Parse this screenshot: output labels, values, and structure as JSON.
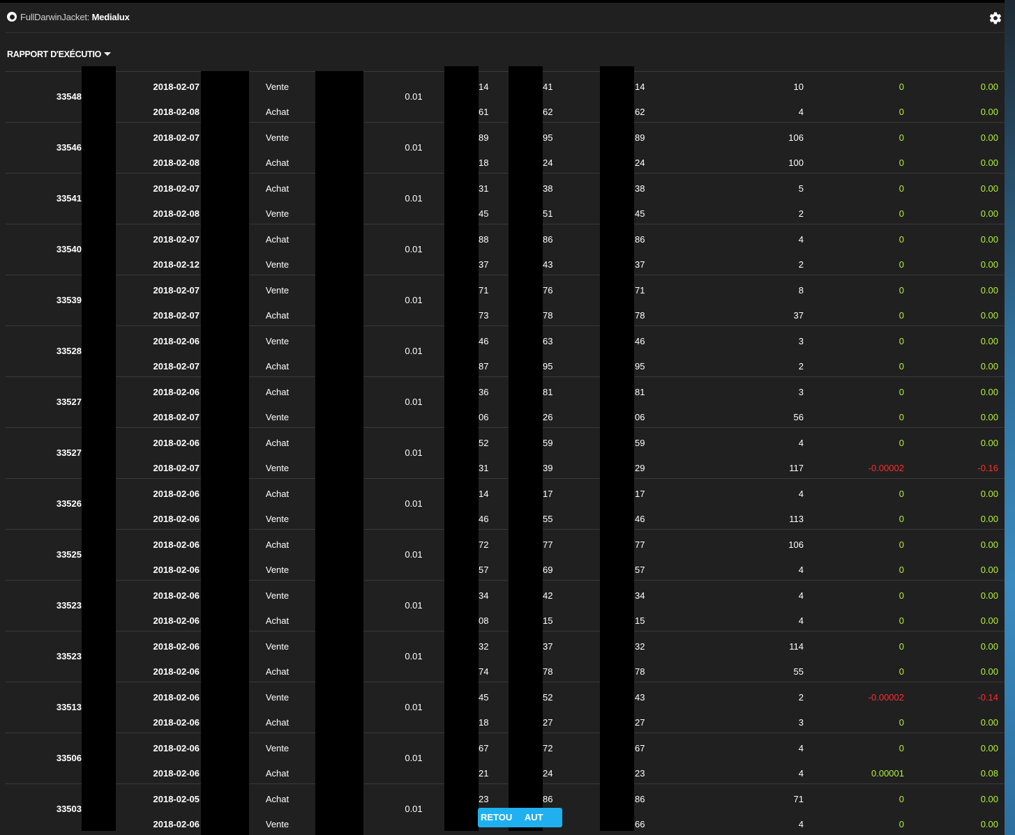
{
  "header": {
    "app_name": "FullDarwinJacket:",
    "app_bold": "Medialux"
  },
  "report_menu": {
    "label": "RAPPORT D'EXÉCUTIO"
  },
  "back_button": {
    "label": "RETOUR EN HAUT",
    "visible_text": "RETOU     AUT"
  },
  "colors": {
    "background": "#202020",
    "positive": "#b4f23a",
    "negative": "#ff2d2d",
    "accent": "#20b0f0"
  },
  "table": {
    "rows": [
      {
        "id": "33548",
        "lot": "0.01",
        "legs": [
          {
            "date": "2018-02-07",
            "type": "Vente",
            "p1": "14",
            "p2": "41",
            "p3": "14",
            "qty": "10",
            "pts": "0",
            "pl": "0.00"
          },
          {
            "date": "2018-02-08",
            "type": "Achat",
            "p1": "61",
            "p2": "62",
            "p3": "62",
            "qty": "4",
            "pts": "0",
            "pl": "0.00"
          }
        ]
      },
      {
        "id": "33546",
        "lot": "0.01",
        "legs": [
          {
            "date": "2018-02-07",
            "type": "Vente",
            "p1": "89",
            "p2": "95",
            "p3": "89",
            "qty": "106",
            "pts": "0",
            "pl": "0.00"
          },
          {
            "date": "2018-02-08",
            "type": "Achat",
            "p1": "18",
            "p2": "24",
            "p3": "24",
            "qty": "100",
            "pts": "0",
            "pl": "0.00"
          }
        ]
      },
      {
        "id": "33541",
        "lot": "0.01",
        "legs": [
          {
            "date": "2018-02-07",
            "type": "Achat",
            "p1": "31",
            "p2": "38",
            "p3": "38",
            "qty": "5",
            "pts": "0",
            "pl": "0.00"
          },
          {
            "date": "2018-02-08",
            "type": "Vente",
            "p1": "45",
            "p2": "51",
            "p3": "45",
            "qty": "2",
            "pts": "0",
            "pl": "0.00"
          }
        ]
      },
      {
        "id": "33540",
        "lot": "0.01",
        "legs": [
          {
            "date": "2018-02-07",
            "type": "Achat",
            "p1": "88",
            "p2": "86",
            "p3": "86",
            "qty": "4",
            "pts": "0",
            "pl": "0.00"
          },
          {
            "date": "2018-02-12",
            "type": "Vente",
            "p1": "37",
            "p2": "43",
            "p3": "37",
            "qty": "2",
            "pts": "0",
            "pl": "0.00"
          }
        ]
      },
      {
        "id": "33539",
        "lot": "0.01",
        "legs": [
          {
            "date": "2018-02-07",
            "type": "Vente",
            "p1": "71",
            "p2": "76",
            "p3": "71",
            "qty": "8",
            "pts": "0",
            "pl": "0.00"
          },
          {
            "date": "2018-02-07",
            "type": "Achat",
            "p1": "73",
            "p2": "78",
            "p3": "78",
            "qty": "37",
            "pts": "0",
            "pl": "0.00"
          }
        ]
      },
      {
        "id": "33528",
        "lot": "0.01",
        "legs": [
          {
            "date": "2018-02-06",
            "type": "Vente",
            "p1": "46",
            "p2": "63",
            "p3": "46",
            "qty": "3",
            "pts": "0",
            "pl": "0.00"
          },
          {
            "date": "2018-02-07",
            "type": "Achat",
            "p1": "87",
            "p2": "95",
            "p3": "95",
            "qty": "2",
            "pts": "0",
            "pl": "0.00"
          }
        ]
      },
      {
        "id": "33527",
        "lot": "0.01",
        "legs": [
          {
            "date": "2018-02-06",
            "type": "Achat",
            "p1": "36",
            "p2": "81",
            "p3": "81",
            "qty": "3",
            "pts": "0",
            "pl": "0.00"
          },
          {
            "date": "2018-02-07",
            "type": "Vente",
            "p1": "06",
            "p2": "26",
            "p3": "06",
            "qty": "56",
            "pts": "0",
            "pl": "0.00"
          }
        ]
      },
      {
        "id": "33527",
        "lot": "0.01",
        "legs": [
          {
            "date": "2018-02-06",
            "type": "Achat",
            "p1": "52",
            "p2": "59",
            "p3": "59",
            "qty": "4",
            "pts": "0",
            "pl": "0.00"
          },
          {
            "date": "2018-02-07",
            "type": "Vente",
            "p1": "31",
            "p2": "39",
            "p3": "29",
            "qty": "117",
            "pts": "-0.00002",
            "pl": "-0.16"
          }
        ]
      },
      {
        "id": "33526",
        "lot": "0.01",
        "legs": [
          {
            "date": "2018-02-06",
            "type": "Achat",
            "p1": "14",
            "p2": "17",
            "p3": "17",
            "qty": "4",
            "pts": "0",
            "pl": "0.00"
          },
          {
            "date": "2018-02-06",
            "type": "Vente",
            "p1": "46",
            "p2": "55",
            "p3": "46",
            "qty": "113",
            "pts": "0",
            "pl": "0.00"
          }
        ]
      },
      {
        "id": "33525",
        "lot": "0.01",
        "legs": [
          {
            "date": "2018-02-06",
            "type": "Achat",
            "p1": "72",
            "p2": "77",
            "p3": "77",
            "qty": "106",
            "pts": "0",
            "pl": "0.00"
          },
          {
            "date": "2018-02-06",
            "type": "Vente",
            "p1": "57",
            "p2": "69",
            "p3": "57",
            "qty": "4",
            "pts": "0",
            "pl": "0.00"
          }
        ]
      },
      {
        "id": "33523",
        "lot": "0.01",
        "legs": [
          {
            "date": "2018-02-06",
            "type": "Vente",
            "p1": "34",
            "p2": "42",
            "p3": "34",
            "qty": "4",
            "pts": "0",
            "pl": "0.00"
          },
          {
            "date": "2018-02-06",
            "type": "Achat",
            "p1": "08",
            "p2": "15",
            "p3": "15",
            "qty": "4",
            "pts": "0",
            "pl": "0.00"
          }
        ]
      },
      {
        "id": "33523",
        "lot": "0.01",
        "legs": [
          {
            "date": "2018-02-06",
            "type": "Vente",
            "p1": "32",
            "p2": "37",
            "p3": "32",
            "qty": "114",
            "pts": "0",
            "pl": "0.00"
          },
          {
            "date": "2018-02-06",
            "type": "Achat",
            "p1": "74",
            "p2": "78",
            "p3": "78",
            "qty": "55",
            "pts": "0",
            "pl": "0.00"
          }
        ]
      },
      {
        "id": "33513",
        "lot": "0.01",
        "legs": [
          {
            "date": "2018-02-06",
            "type": "Vente",
            "p1": "45",
            "p2": "52",
            "p3": "43",
            "qty": "2",
            "pts": "-0.00002",
            "pl": "-0.14"
          },
          {
            "date": "2018-02-06",
            "type": "Achat",
            "p1": "18",
            "p2": "27",
            "p3": "27",
            "qty": "3",
            "pts": "0",
            "pl": "0.00"
          }
        ]
      },
      {
        "id": "33506",
        "lot": "0.01",
        "legs": [
          {
            "date": "2018-02-06",
            "type": "Vente",
            "p1": "67",
            "p2": "72",
            "p3": "67",
            "qty": "4",
            "pts": "0",
            "pl": "0.00"
          },
          {
            "date": "2018-02-06",
            "type": "Achat",
            "p1": "21",
            "p2": "24",
            "p3": "23",
            "qty": "4",
            "pts": "0.00001",
            "pl": "0.08"
          }
        ]
      },
      {
        "id": "33503",
        "lot": "0.01",
        "legs": [
          {
            "date": "2018-02-05",
            "type": "Achat",
            "p1": "23",
            "p2": "86",
            "p3": "86",
            "qty": "71",
            "pts": "0",
            "pl": "0.00"
          },
          {
            "date": "2018-02-06",
            "type": "Vente",
            "p1": "",
            "p2": "",
            "p3": "66",
            "qty": "4",
            "pts": "0",
            "pl": "0.00"
          }
        ]
      }
    ]
  }
}
